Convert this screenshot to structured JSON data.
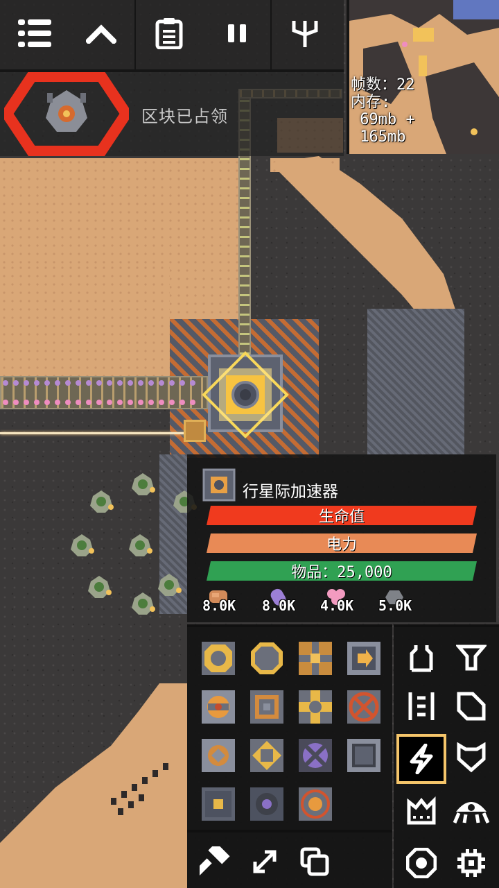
{
  "hud": {
    "buttons": [
      "menu-icon",
      "chevron-up-icon",
      "clipboard-icon",
      "pause-icon",
      "tech-tree-icon"
    ]
  },
  "wave": {
    "status": "区块已占领"
  },
  "minimap": {
    "fps_label": "帧数：22",
    "memory_label": "内存:",
    "memory_line1": " 69mb +",
    "memory_line2": " 165mb"
  },
  "block_info": {
    "name": "行星际加速器",
    "health_label": "生命值",
    "power_label": "电力",
    "items_label": "物品：25,000",
    "resources": [
      {
        "icon": "copper-icon",
        "value": "8.0K",
        "color": "#d38b5a"
      },
      {
        "icon": "plastanium-icon",
        "value": "8.0K",
        "color": "#9c7fd6"
      },
      {
        "icon": "phase-fabric-icon",
        "value": "4.0K",
        "color": "#f29bc0"
      },
      {
        "icon": "silicon-icon",
        "value": "5.0K",
        "color": "#7f8288"
      }
    ]
  },
  "build_menu": {
    "blocks": [
      "core-shard-block",
      "core-foundation-block",
      "mass-driver-block",
      "unloader-block",
      "power-node-block",
      "container-block",
      "bridge-block",
      "overflow-gate-block",
      "sorter-block",
      "router-block",
      "plastanium-block",
      "vault-block",
      "payload-block",
      "distributor-block",
      "launch-pad-block"
    ],
    "categories": [
      "turret-icon",
      "production-icon",
      "distribution-icon",
      "liquid-icon",
      "power-icon",
      "defense-icon",
      "crafting-icon",
      "units-icon",
      "effect-icon",
      "logic-icon"
    ],
    "selected_category": "power-icon",
    "tools": [
      "hammer-icon",
      "expand-icon",
      "copy-icon"
    ]
  },
  "colors": {
    "accent": "#f5c56a",
    "health": "#f03a1e",
    "power": "#e88a56",
    "items": "#30a153",
    "enemy_frame": "#e8321e"
  }
}
